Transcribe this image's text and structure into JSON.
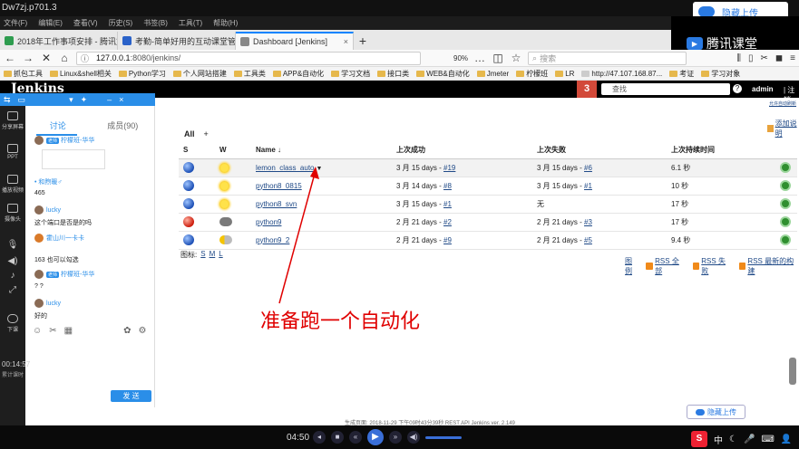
{
  "window": {
    "title": "Dw7zj.p701.3",
    "upload_label": "隐藏上传",
    "upload_label_bottom": "隐藏上传"
  },
  "browser": {
    "menu": [
      "文件(F)",
      "编辑(E)",
      "查看(V)",
      "历史(S)",
      "书签(B)",
      "工具(T)",
      "帮助(H)"
    ],
    "tabs": [
      {
        "label": "2018年工作事项安排 - 腾讯文",
        "favicon_color": "#2e9c4f"
      },
      {
        "label": "考勤-简单好用的互动课堂管理",
        "favicon_color": "#2a62c9"
      },
      {
        "label": "Dashboard [Jenkins]",
        "favicon_color": "#888888",
        "active": true
      }
    ],
    "new_tab": "+",
    "url_host": "127.0.0.1",
    "url_path": ":8080/jenkins/",
    "zoom": "90%",
    "search_placeholder": "搜索",
    "bookmarks": [
      "抓包工具",
      "Linux&shell相关",
      "Python学习",
      "个人网站搭建",
      "工具类",
      "APP&自动化",
      "学习文档",
      "接口类",
      "WEB&自动化",
      "Jmeter",
      "柠檬班",
      "LR",
      "http://47.107.168.87...",
      "考证",
      "学习对象"
    ]
  },
  "tencent": {
    "brand": "腾讯课堂"
  },
  "jenkins": {
    "logo": "Jenkins",
    "badge": "3",
    "search_placeholder": "查找",
    "help": "?",
    "user": "admin",
    "logout": "| 注销",
    "auto_refresh": "允许自动刷新",
    "add_description": "添加说明",
    "view_tab": "All",
    "view_add": "+",
    "columns": {
      "s": "S",
      "w": "W",
      "name": "Name ↓",
      "last_success": "上次成功",
      "last_failure": "上次失败",
      "last_duration": "上次持续时间"
    },
    "jobs": [
      {
        "name": "lemon_class_auto",
        "status": "blue",
        "weather": "sun",
        "last_success": "3 月 15 days - ",
        "success_build": "#19",
        "last_failure": "3 月 15 days - ",
        "failure_build": "#6",
        "duration": "6.1 秒"
      },
      {
        "name": "python8_0815",
        "status": "blue",
        "weather": "sun",
        "last_success": "3 月 14 days - ",
        "success_build": "#8",
        "last_failure": "3 月 15 days - ",
        "failure_build": "#1",
        "duration": "10 秒"
      },
      {
        "name": "python8_svn",
        "status": "blue",
        "weather": "sun",
        "last_success": "3 月 15 days - ",
        "success_build": "#1",
        "last_failure": "无",
        "failure_build": "",
        "duration": "17 秒"
      },
      {
        "name": "python9",
        "status": "red",
        "weather": "storm",
        "last_success": "2 月 21 days - ",
        "success_build": "#2",
        "last_failure": "2 月 21 days - ",
        "failure_build": "#3",
        "duration": "17 秒"
      },
      {
        "name": "python9_2",
        "status": "blue",
        "weather": "cloudy",
        "last_success": "2 月 21 days - ",
        "success_build": "#9",
        "last_failure": "2 月 21 days - ",
        "failure_build": "#5",
        "duration": "9.4 秒"
      }
    ],
    "legend_label": "图标:",
    "legend_sizes": [
      "S",
      "M",
      "L"
    ],
    "links": {
      "legend": "图例",
      "rss_all": "RSS 全部",
      "rss_failed": "RSS 失败",
      "rss_latest": "RSS 最新的构建"
    },
    "footer": "生成页面: 2018-11-29 下午09时43分39秒 REST API Jenkins ver. 2.149"
  },
  "annotation": "准备跑一个自动化",
  "chat": {
    "tabs": [
      "讨论",
      "成员(90)"
    ],
    "side": [
      "分享屏幕",
      "PPT",
      "播放视频",
      "摄像头",
      "下课"
    ],
    "messages": [
      {
        "name": "柠檬班-华华",
        "tag": "老师",
        "text": ""
      },
      {
        "name": "• 和煦暖♂",
        "tag": "",
        "text": "465"
      },
      {
        "name": "lucky",
        "tag": "",
        "text": "这个端口是否是的吗"
      },
      {
        "name": "霍山川一卡卡",
        "tag": "",
        "text": "163 也可以勾选"
      },
      {
        "name": "柠檬班-华华",
        "tag": "老师",
        "text": "? ?"
      },
      {
        "name": "lucky",
        "tag": "",
        "text": "好的"
      }
    ],
    "send": "发 送",
    "timer": "00:14:57",
    "timer_label": "累计课时"
  },
  "media": {
    "time": "04:50"
  },
  "ime": {
    "brand": "S",
    "lang": "中"
  }
}
